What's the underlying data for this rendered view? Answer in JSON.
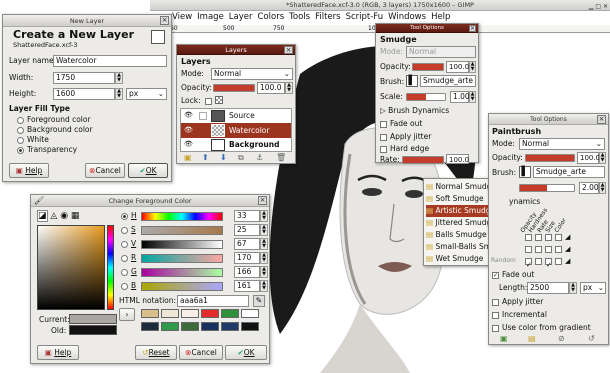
{
  "main_window": {
    "title": "*ShatteredFace.xcf-3.0 (RGB, 3 layers) 1750x1600 – GIMP",
    "menus": [
      "View",
      "Image",
      "Layer",
      "Colors",
      "Tools",
      "Filters",
      "Script-Fu",
      "Windows",
      "Help"
    ],
    "ruler_marks": [
      "50",
      "500",
      "750",
      "1000"
    ]
  },
  "new_layer": {
    "title": "New Layer",
    "heading": "Create a New Layer",
    "subtitle": "ShatteredFace.xcf-3",
    "name_label": "Layer name:",
    "name_value": "Watercolor",
    "width_label": "Width:",
    "width_value": "1750",
    "height_label": "Height:",
    "height_value": "1600",
    "unit": "px",
    "fill_type_label": "Layer Fill Type",
    "fill_options": [
      "Foreground color",
      "Background color",
      "White",
      "Transparency"
    ],
    "selected_fill": "Transparency",
    "help": "Help",
    "cancel": "Cancel",
    "ok": "OK"
  },
  "layers": {
    "title": "Layers",
    "panel_title": "Layers",
    "mode_label": "Mode:",
    "mode": "Normal",
    "opacity_label": "Opacity:",
    "opacity": "100.0",
    "lock_label": "Lock:",
    "items": [
      "Source",
      "Watercolor",
      "Background"
    ],
    "selected": "Watercolor"
  },
  "tool_options_1": {
    "title": "Tool Options",
    "tool": "Smudge",
    "mode_label": "Mode:",
    "mode": "Normal",
    "opacity_label": "Opacity:",
    "opacity": "100.0",
    "brush_label": "Brush:",
    "brush": "Smudge_arte",
    "scale_label": "Scale:",
    "scale": "1.00",
    "dynamics": "Brush Dynamics",
    "fade_out": "Fade out",
    "jitter": "Apply jitter",
    "hard_edge": "Hard edge",
    "rate_label": "Rate:",
    "rate": "100.0"
  },
  "brush_menu": {
    "items": [
      "Normal Smudge",
      "Soft Smudge",
      "Artistic Smudge",
      "Jittered Smudge",
      "Balls Smudge",
      "Small-Balls Smudge",
      "Wet Smudge"
    ],
    "selected": "Artistic Smudge"
  },
  "tool_options_2": {
    "title": "Tool Options",
    "tool": "Paintbrush",
    "mode_label": "Mode:",
    "mode": "Normal",
    "opacity_label": "Opacity:",
    "opacity": "100.0",
    "brush_label": "Brush:",
    "brush": "Smudge_arte",
    "scale": "2.00",
    "dynamics_partial": "ynamics",
    "dyn_headers": [
      "Opacity",
      "Hardness",
      "Rate",
      "Size",
      "Color"
    ],
    "random_label": "Random",
    "fade_out": "Fade out",
    "length_label": "Length:",
    "length": "2500",
    "length_unit": "px",
    "jitter": "Apply jitter",
    "incremental": "Incremental",
    "gradient": "Use color from gradient"
  },
  "color_dialog": {
    "title": "Change Foreground Color",
    "channels": [
      {
        "label": "H",
        "value": "33"
      },
      {
        "label": "S",
        "value": "25"
      },
      {
        "label": "V",
        "value": "67"
      },
      {
        "label": "R",
        "value": "170"
      },
      {
        "label": "G",
        "value": "166"
      },
      {
        "label": "B",
        "value": "161"
      }
    ],
    "html_label": "HTML notation:",
    "html_value": "aaa6a1",
    "current_label": "Current:",
    "old_label": "Old:",
    "help": "Help",
    "reset": "Reset",
    "cancel": "Cancel",
    "ok": "OK",
    "fg_color": "#aaa6a1"
  }
}
